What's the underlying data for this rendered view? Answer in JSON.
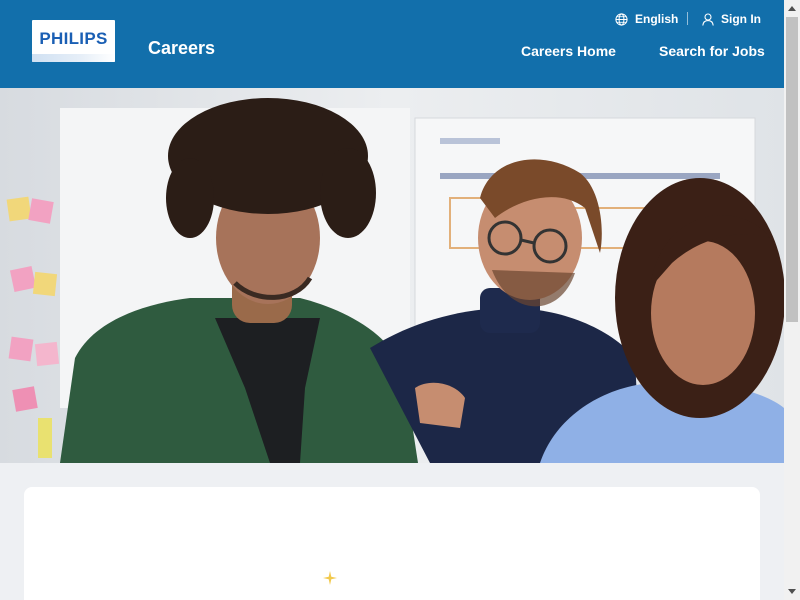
{
  "header": {
    "logo_text": "PHILIPS",
    "title": "Careers",
    "language": {
      "label": "English",
      "icon": "globe-icon"
    },
    "sign_in": {
      "label": "Sign In",
      "icon": "user-icon"
    },
    "nav": [
      {
        "label": "Careers Home"
      },
      {
        "label": "Search for Jobs"
      }
    ]
  },
  "hero": {
    "image_alt": "",
    "icon": "hero-photo"
  },
  "colors": {
    "header_bg": "#126fab",
    "page_bg": "#eef0f3",
    "card_bg": "#ffffff",
    "sparkle": "#f2c94c"
  }
}
